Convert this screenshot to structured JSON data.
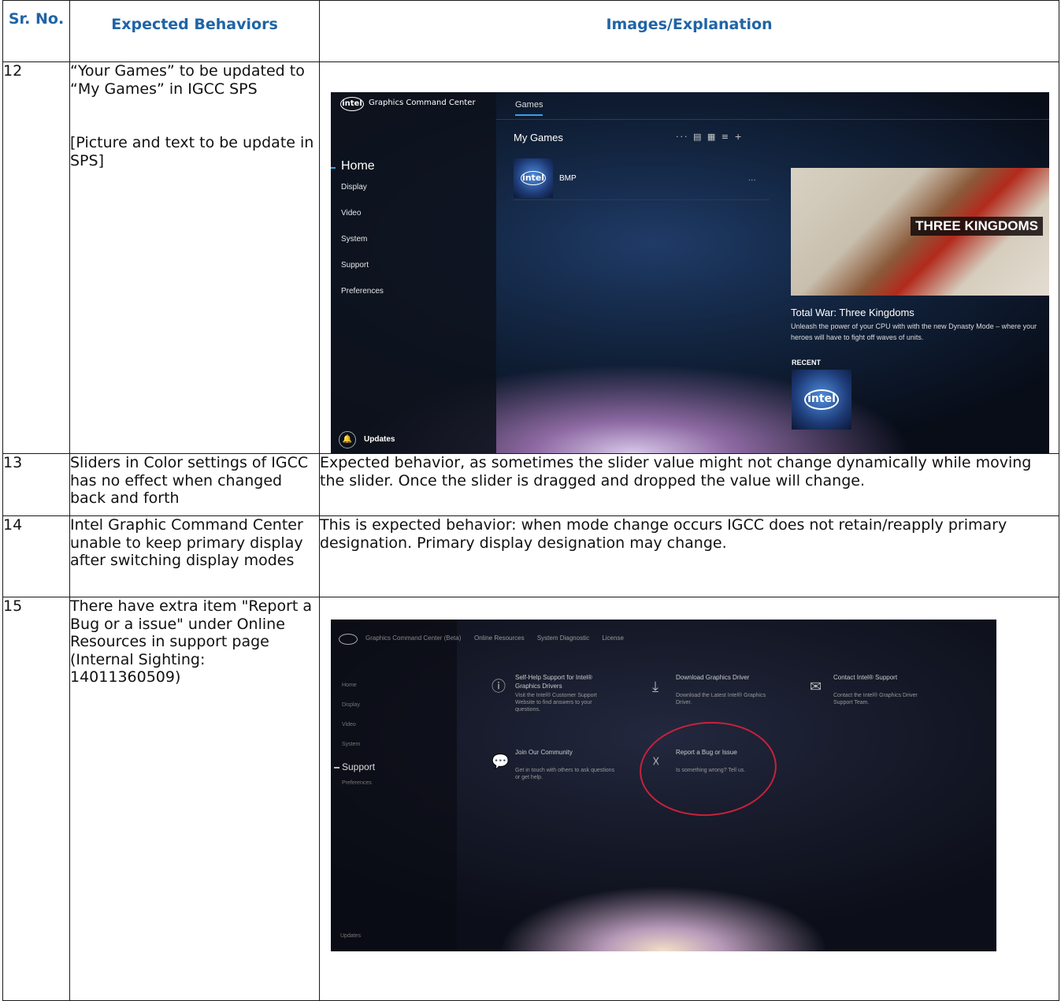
{
  "table": {
    "headers": [
      "Sr. No.",
      "Expected Behaviors",
      "Images/Explanation"
    ],
    "rows": [
      {
        "no": "12",
        "behavior": "“Your Games” to be updated to “My Games” in IGCC SPS",
        "note": "[Picture and text to be update in SPS]"
      },
      {
        "no": "13",
        "behavior": "Sliders in Color settings of IGCC has no effect when changed back and forth",
        "explanation": "Expected behavior, as sometimes the slider value might not change dynamically while moving the slider. Once the slider is dragged and dropped the value will change."
      },
      {
        "no": "14",
        "behavior": "Intel Graphic Command Center unable to keep primary display after switching display modes",
        "explanation": "This is expected behavior:  when mode change occurs IGCC does not retain/reapply primary designation. Primary display designation may change."
      },
      {
        "no": "15",
        "behavior": "There have extra item \"Report a Bug or a issue\" under Online Resources in support page (Internal Sighting: 14011360509)"
      }
    ]
  },
  "shot1": {
    "logo": "intel",
    "app_title": "Graphics Command Center",
    "tab": "Games",
    "nav": [
      "Home",
      "Display",
      "Video",
      "System",
      "Support",
      "Preferences"
    ],
    "section_title": "My Games",
    "toolbar": "··· ▤ ▦ ≡ +",
    "game_name": "BMP",
    "thumb_logo": "intel",
    "promo_logo": "THREE KINGDOMS",
    "promo_title": "Total War: Three Kingdoms",
    "promo_desc": "Unleash the power of your CPU with with the new Dynasty Mode – where your heroes will have to fight off waves of units.",
    "recent_label": "RECENT",
    "updates_label": "Updates"
  },
  "shot2": {
    "app_title": "Graphics Command Center (Beta)",
    "tabs": [
      "Online Resources",
      "System Diagnostic",
      "License"
    ],
    "nav": [
      "Home",
      "Display",
      "Video",
      "System",
      "Support",
      "Preferences"
    ],
    "updates_label": "Updates",
    "cards": [
      {
        "title": "Self-Help Support for Intel® Graphics Drivers",
        "desc": "Visit the Intel® Customer Support Website to find answers to your questions."
      },
      {
        "title": "Download Graphics Driver",
        "desc": "Download the Latest Intel® Graphics Driver."
      },
      {
        "title": "Contact Intel® Support",
        "desc": "Contact the Intel® Graphics Driver Support Team."
      },
      {
        "title": "Join Our Community",
        "desc": "Get in touch with others to ask questions or get help."
      },
      {
        "title": "Report a Bug or Issue",
        "desc": "Is something wrong? Tell us."
      }
    ]
  }
}
